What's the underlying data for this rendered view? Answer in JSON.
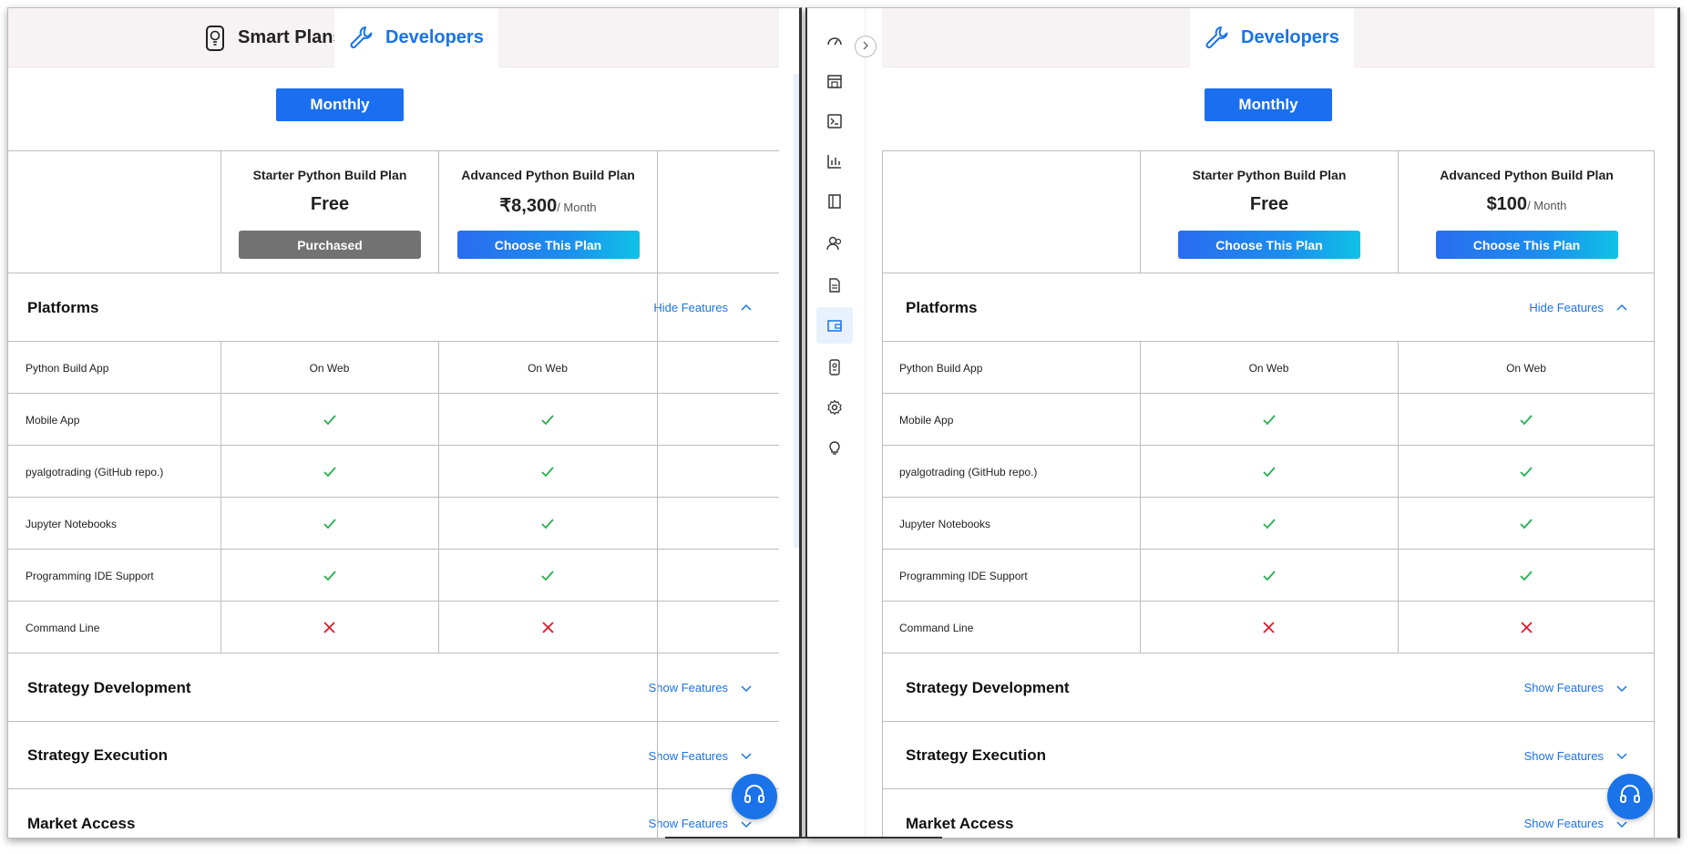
{
  "left_window": {
    "tabs": [
      {
        "label": "Smart Plans",
        "icon": "smart-plans-icon",
        "active": false
      },
      {
        "label": "Developers",
        "icon": "wrench-icon",
        "active": true
      }
    ],
    "billing_toggle": "Monthly",
    "plans": [
      {
        "name": "Starter Python Build Plan",
        "price": "Free",
        "period": "",
        "button": "Purchased",
        "button_state": "disabled"
      },
      {
        "name": "Advanced Python Build Plan",
        "price": "₹8,300",
        "period": "/ Month",
        "button": "Choose This Plan",
        "button_state": "active"
      }
    ]
  },
  "right_window": {
    "tabs": [
      {
        "label": "Developers",
        "icon": "wrench-icon",
        "active": true
      }
    ],
    "billing_toggle": "Monthly",
    "plans": [
      {
        "name": "Starter Python Build Plan",
        "price": "Free",
        "period": "",
        "button": "Choose This Plan",
        "button_state": "active"
      },
      {
        "name": "Advanced Python Build Plan",
        "price": "$100",
        "period": "/ Month",
        "button": "Choose This Plan",
        "button_state": "active"
      }
    ],
    "sidebar_icons": [
      "dashboard-icon",
      "store-icon",
      "terminal-icon",
      "chart-icon",
      "book-icon",
      "users-icon",
      "document-icon",
      "wallet-icon",
      "device-icon",
      "gear-icon",
      "lightbulb-icon"
    ]
  },
  "sections": {
    "platforms": {
      "title": "Platforms",
      "toggle": "Hide Features"
    },
    "strategy_development": {
      "title": "Strategy Development",
      "toggle": "Show Features"
    },
    "strategy_execution": {
      "title": "Strategy Execution",
      "toggle": "Show Features"
    },
    "market_access": {
      "title": "Market Access",
      "toggle": "Show Features"
    }
  },
  "features": [
    {
      "label": "Python Build App",
      "starter": "On Web",
      "advanced": "On Web"
    },
    {
      "label": "Mobile App",
      "starter": "check",
      "advanced": "check"
    },
    {
      "label": "pyalgotrading (GitHub repo.)",
      "starter": "check",
      "advanced": "check"
    },
    {
      "label": "Jupyter Notebooks",
      "starter": "check",
      "advanced": "check"
    },
    {
      "label": "Programming IDE Support",
      "starter": "check",
      "advanced": "check"
    },
    {
      "label": "Command Line",
      "starter": "cross",
      "advanced": "cross"
    }
  ],
  "colors": {
    "accent": "#1a73e8",
    "check": "#22b14c",
    "cross": "#e0192b",
    "purchased": "#727272"
  }
}
